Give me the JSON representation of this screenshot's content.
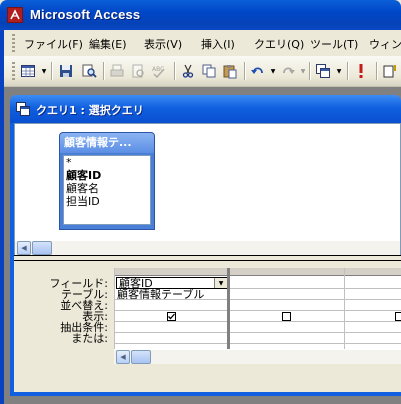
{
  "app": {
    "title": "Microsoft Access"
  },
  "menu": {
    "items": [
      {
        "label": "ファイル(F)",
        "name": "menu-file"
      },
      {
        "label": "編集(E)",
        "name": "menu-edit"
      },
      {
        "label": "表示(V)",
        "name": "menu-view"
      },
      {
        "label": "挿入(I)",
        "name": "menu-insert"
      },
      {
        "label": "クエリ(Q)",
        "name": "menu-query"
      },
      {
        "label": "ツール(T)",
        "name": "menu-tools"
      },
      {
        "label": "ウィンド",
        "name": "menu-window"
      }
    ]
  },
  "toolbar": {
    "icons": [
      "view-icon",
      "save-icon",
      "search-file-icon",
      "print-icon",
      "print-preview-icon",
      "spelling-icon",
      "cut-icon",
      "copy-icon",
      "paste-icon",
      "undo-icon",
      "redo-icon",
      "query-type-icon",
      "run-icon"
    ]
  },
  "query_window": {
    "title": "クエリ1 : 選択クエリ"
  },
  "field_list": {
    "title": "顧客情報テ...",
    "items": [
      {
        "label": "*",
        "bold": false
      },
      {
        "label": "顧客ID",
        "bold": true
      },
      {
        "label": "顧客名",
        "bold": false
      },
      {
        "label": "担当ID",
        "bold": false
      }
    ]
  },
  "grid": {
    "row_labels": [
      "フィールド:",
      "テーブル:",
      "並べ替え:",
      "表示:",
      "抽出条件:",
      "または:"
    ],
    "columns": [
      {
        "field": "顧客ID",
        "table": "顧客情報テーブル",
        "sort": "",
        "show": true,
        "criteria": "",
        "or": ""
      },
      {
        "field": "",
        "table": "",
        "sort": "",
        "show": false,
        "criteria": "",
        "or": ""
      },
      {
        "field": "",
        "table": "",
        "sort": "",
        "show": false,
        "criteria": "",
        "or": ""
      }
    ]
  }
}
